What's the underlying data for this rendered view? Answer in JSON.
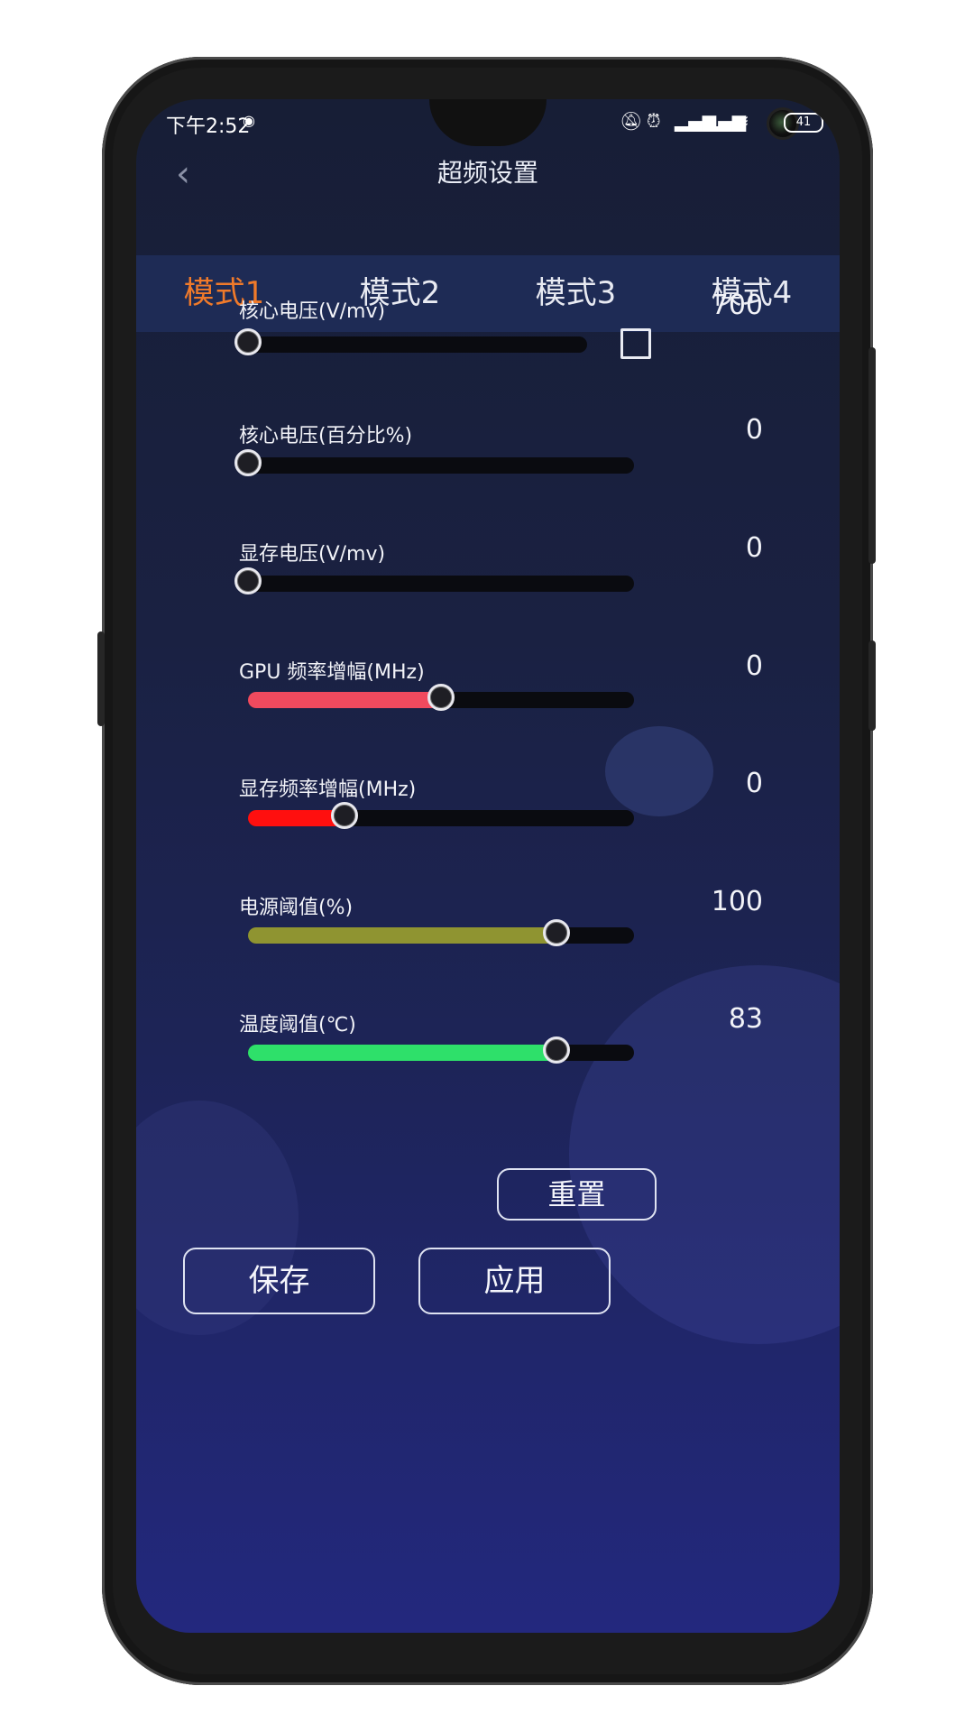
{
  "status": {
    "time": "下午2:52",
    "battery": "41"
  },
  "header": {
    "title": "超频设置",
    "back_icon": "chevron-left-icon"
  },
  "tabs": [
    {
      "label": "模式1",
      "active": true
    },
    {
      "label": "模式2",
      "active": false
    },
    {
      "label": "模式3",
      "active": false
    },
    {
      "label": "模式4",
      "active": false
    }
  ],
  "sliders": [
    {
      "label": "核心电压(V/mv)",
      "value": "700",
      "level": 0.0,
      "color": null
    },
    {
      "label": "核心电压(百分比%)",
      "value": "0",
      "level": 0.0,
      "color": null
    },
    {
      "label": "显存电压(V/mv)",
      "value": "0",
      "level": 0.0,
      "color": null
    },
    {
      "label": "GPU 频率增幅(MHz)",
      "value": "0",
      "level": 0.5,
      "color": "#f04a5e"
    },
    {
      "label": "显存频率增幅(MHz)",
      "value": "0",
      "level": 0.25,
      "color": "#ff0f0f"
    },
    {
      "label": "电源阈值(%)",
      "value": "100",
      "level": 0.8,
      "color": "#8f9431"
    },
    {
      "label": "温度阈值(℃)",
      "value": "83",
      "level": 0.8,
      "color": "#2ee06a"
    }
  ],
  "buttons": {
    "reset": "重置",
    "save": "保存",
    "apply": "应用"
  },
  "colors": {
    "accent": "#f07a2a",
    "tab_bar": "#1e2b55"
  }
}
